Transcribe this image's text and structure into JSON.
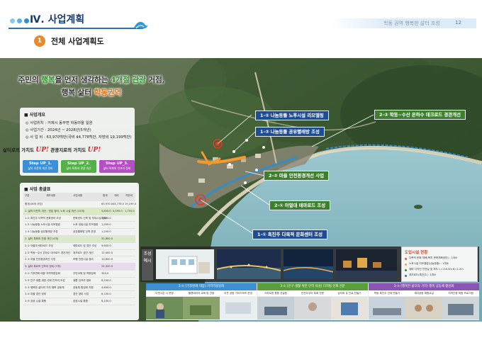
{
  "header": {
    "section_title": "Ⅳ. 사업계획",
    "subtitle_right": "힉동 권역 행복한 삶터 조성",
    "page_number": "12",
    "item_number": "1",
    "item_title": "전체 사업계획도"
  },
  "slogan": {
    "line1_a": "주민의 ",
    "line1_b": "행복",
    "line1_c": "을 먼저 생각하는 ",
    "line1_d": "4개절 관광",
    "line1_e": " 거점,",
    "line2_a": "행복 삶터 ",
    "line2_b": "학동권역"
  },
  "overview": {
    "heading": "■ 사업개요",
    "location": "◎ 사업위치 : 거제시 동부면 학동마을 일원",
    "period": "◎ 사업기간 : 2024년 ~ 2028년(5개년)",
    "budget": "◎ 사 업 비 : 63,970백만(국비 44,778백만, 자방비 19,199백만)"
  },
  "value_up": {
    "part1": "삶터로의 가치도 ",
    "up": "UP!",
    "part2": " 관광지로의 가치도 ",
    "steps": [
      {
        "title": "Step UP_1.",
        "desc": "삶의 터전의 개선 정비",
        "color": "#3a8fd6"
      },
      {
        "title": "Step UP_2.",
        "desc": "삶터 특화의 관광 개선",
        "color": "#56b04a"
      },
      {
        "title": "Step UP_3.",
        "desc": "삶터 특화의 인프라 정비",
        "color": "#b34fc2"
      }
    ]
  },
  "budget_table": {
    "heading": "■ 사업 총괄표",
    "col_headers": [
      "구분",
      "세부내용",
      "사업내용",
      "사업비",
      "합계",
      "국비",
      "지방비"
    ],
    "rows": [
      {
        "c1": "합계(16개 사업)",
        "c2": "",
        "v1": "63,970.0",
        "v2": "44,778.0",
        "v3": "19,199.0",
        "kind": "normal"
      },
      {
        "c1": "1. 삶의 터전의 개선 : 빈집 정비, 노후 시설 개선 (15개)",
        "c2": "",
        "v1": "5,850.0",
        "v2": "4,095.0",
        "v3": "1,755.0",
        "kind": "grp"
      },
      {
        "c1": "1-① 흑진주 다목적 문화센터 조성",
        "c2": "문화센터 신축 및 부대시설 정비",
        "v1": "3,600.0",
        "v2": "",
        "v3": "",
        "kind": "normal"
      },
      {
        "c1": "1-② 나눔동뜰 노후시설 리모델링",
        "c2": "노후 공동시설 리모델링",
        "v1": "1,050.0",
        "v2": "",
        "v3": "",
        "kind": "normal"
      },
      {
        "c1": "1-③ 나눔동뜰 공유빨래방 조성",
        "c2": "공유빨래방 신축 운영",
        "v1": "1,200.0",
        "v2": "",
        "v3": "",
        "kind": "normal"
      },
      {
        "c1": "2. 삶터 특화의 관광 개선 (4개)",
        "c2": "",
        "v1": "32,800.0",
        "v2": "",
        "v3": "",
        "kind": "grp"
      },
      {
        "c1": "2-① 아멀대 테마로드 조성",
        "c2": "테마로드 및 경관 조성",
        "v1": "9,600.0",
        "v2": "",
        "v3": "",
        "kind": "normal"
      },
      {
        "c1": "2-② 학동~수산 은하수 데크로드 경관개선",
        "c2": "데크로드 경관 개선",
        "v1": "12,400.0",
        "v2": "",
        "v3": "",
        "kind": "normal"
      },
      {
        "c1": "2-③ 마을 안전환경개선 사업",
        "c2": "보행 안전시설 정비",
        "v1": "10,800.0",
        "v2": "",
        "v3": "",
        "kind": "normal"
      },
      {
        "c1": "3. 삶터 특화의 인프라 정비 (7개)",
        "c2": "",
        "v1": "25,320.0",
        "v2": "",
        "v3": "",
        "kind": "grp2"
      },
      {
        "c1": "3-① 기후변화 대응 지역역량강화",
        "c2": "주민교육 및 역량강화",
        "v1": "320.0",
        "v2": "",
        "v3": "",
        "kind": "normal"
      },
      {
        "c1": "3-② 인구·생활 위한 사회 인프라 조성",
        "c2": "생활 인프라 정비",
        "v1": "8,200.0",
        "v2": "",
        "v3": "",
        "kind": "normal"
      },
      {
        "c1": "3-③ 행복한 삶터의 가치 행복 공동체",
        "c2": "공동체 활성화 지원",
        "v1": "4,600.0",
        "v2": "",
        "v3": "",
        "kind": "normal"
      },
      {
        "c1": "3-④ 마을 경관 정비",
        "c2": "경관 정비 사업",
        "v1": "6,100.0",
        "v2": "",
        "v3": "",
        "kind": "normal"
      },
      {
        "c1": "3-⑤ 공공 시설 확충",
        "c2": "공공시설 확충",
        "v1": "6,100.0",
        "v2": "",
        "v3": "",
        "kind": "normal"
      }
    ]
  },
  "callouts": [
    {
      "label": "1-② 나눔동뜰 노후시설 리모델링",
      "color": "blue"
    },
    {
      "label": "1-③ 나눔동뜰 공유빨래방 조성",
      "color": "blue"
    },
    {
      "label": "2-② 학동~수산 은하수 데크로드 경관개선",
      "color": "green"
    },
    {
      "label": "2-③ 마을 안전환경개선 사업",
      "color": "green"
    },
    {
      "label": "2-① 아멀대 테마로드 조성",
      "color": "green"
    },
    {
      "label": "1-① 흑진주 다목적 문화센터 조성",
      "color": "blue"
    }
  ],
  "render_label": "조성예시",
  "legend": {
    "heading": "도입시설 현황",
    "items": [
      {
        "text": "다목적 문화 체육(복지 문화체육센터) : 1개소",
        "color": "#e25a2a"
      },
      {
        "text": "노후시설 리모델링(나눔동뜰) : 1개소",
        "color": "#f2a23a"
      },
      {
        "text": "테마 디자인 안전길 및 보도 L=116.0m B=1.2m",
        "color": "#3c7f2d"
      },
      {
        "text": "데크로드(흑진주) : 1개소",
        "color": "#2c6fb4"
      }
    ]
  },
  "programs": [
    {
      "head": "3-① [기후변화 대응] 지역역량강화",
      "color": "#3d8fd0",
      "subs": [
        "이웃사촌 시 운영",
        "플랜테리어 교육 및 관광",
        "이웃 공동 가이드하프 운영"
      ]
    },
    {
      "head": "3-② [인구·생활 위한 인력 육성] 디지털 인재 전문",
      "color": "#5b9d3a",
      "subs": [
        "스마트팜 활용 컨설팅",
        "안전도우미 특화 전문",
        "삼터와 유 진로 만들기"
      ]
    },
    {
      "head": "3-③ [행복한 삶터의 가치] 행복 공동체 활성화",
      "color": "#8a55b2",
      "subs": [
        "학동 흑진주 인재 만들기",
        "세대공동 체험교실",
        "지역관광 체험 프로그램"
      ]
    }
  ]
}
